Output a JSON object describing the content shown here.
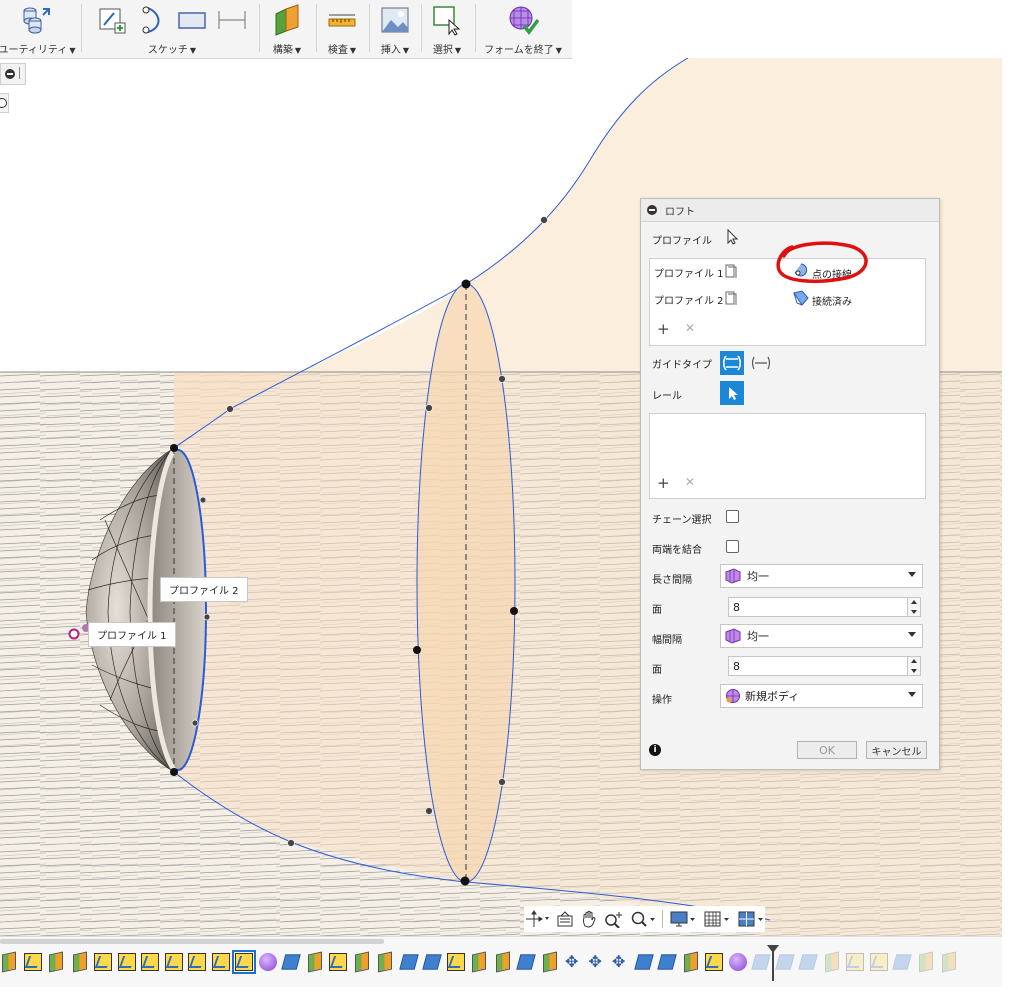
{
  "ribbon": {
    "groups": [
      {
        "label": "ユーティリティ",
        "icon": "utility-cylinders-icon"
      },
      {
        "label": "スケッチ",
        "icon": "sketch-tools-icon"
      },
      {
        "label": "構築",
        "icon": "construct-planes-icon"
      },
      {
        "label": "検査",
        "icon": "inspect-ruler-icon"
      },
      {
        "label": "挿入",
        "icon": "insert-image-icon"
      },
      {
        "label": "選択",
        "icon": "select-arrow-icon"
      },
      {
        "label": "フォームを終了",
        "icon": "finish-form-icon"
      }
    ]
  },
  "viewport": {
    "tag_profile1": "プロファイル 1",
    "tag_profile2": "プロファイル 2",
    "colors": {
      "sheet": "#fbeedd",
      "floor_line": "#8a8a8a",
      "curve": "#2a5bd7",
      "point": "#111111"
    }
  },
  "loft": {
    "title": "ロフト",
    "profile_label": "プロファイル",
    "rows": [
      {
        "name": "プロファイル 1",
        "status": "点の接線"
      },
      {
        "name": "プロファイル 2",
        "status": "接続済み"
      }
    ],
    "guide_type_label": "ガイドタイプ",
    "rail_label": "レール",
    "chain_select_label": "チェーン選択",
    "join_ends_label": "両端を結合",
    "length_spacing_label": "長さ間隔",
    "length_spacing_value": "均一",
    "faces_label_1": "面",
    "faces_value_1": "8",
    "width_spacing_label": "幅間隔",
    "width_spacing_value": "均一",
    "faces_label_2": "面",
    "faces_value_2": "8",
    "operation_label": "操作",
    "operation_value": "新規ボディ",
    "ok_label": "OK",
    "cancel_label": "キャンセル",
    "annotation_color": "#e01010"
  }
}
